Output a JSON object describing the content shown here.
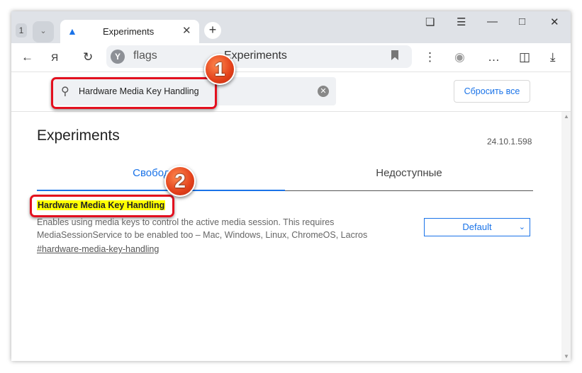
{
  "tabstrip": {
    "tab_count": "1",
    "tab_title": "Experiments"
  },
  "toolbar": {
    "url": "flags",
    "page_title": "Experiments"
  },
  "search": {
    "value": "Hardware Media Key Handling",
    "reset_label": "Сбросить все"
  },
  "page": {
    "title": "Experiments",
    "version": "24.10.1.598",
    "tabs": [
      {
        "label": "Свободные",
        "active": true
      },
      {
        "label": "Недоступные",
        "active": false
      }
    ]
  },
  "flag": {
    "title": "Hardware Media Key Handling",
    "description": "Enables using media keys to control the active media session. This requires MediaSessionService to be enabled too – Mac, Windows, Linux, ChromeOS, Lacros",
    "anchor": "#hardware-media-key-handling",
    "selected": "Default"
  },
  "annotations": {
    "badge1": "1",
    "badge2": "2",
    "color": "#e3101f"
  }
}
